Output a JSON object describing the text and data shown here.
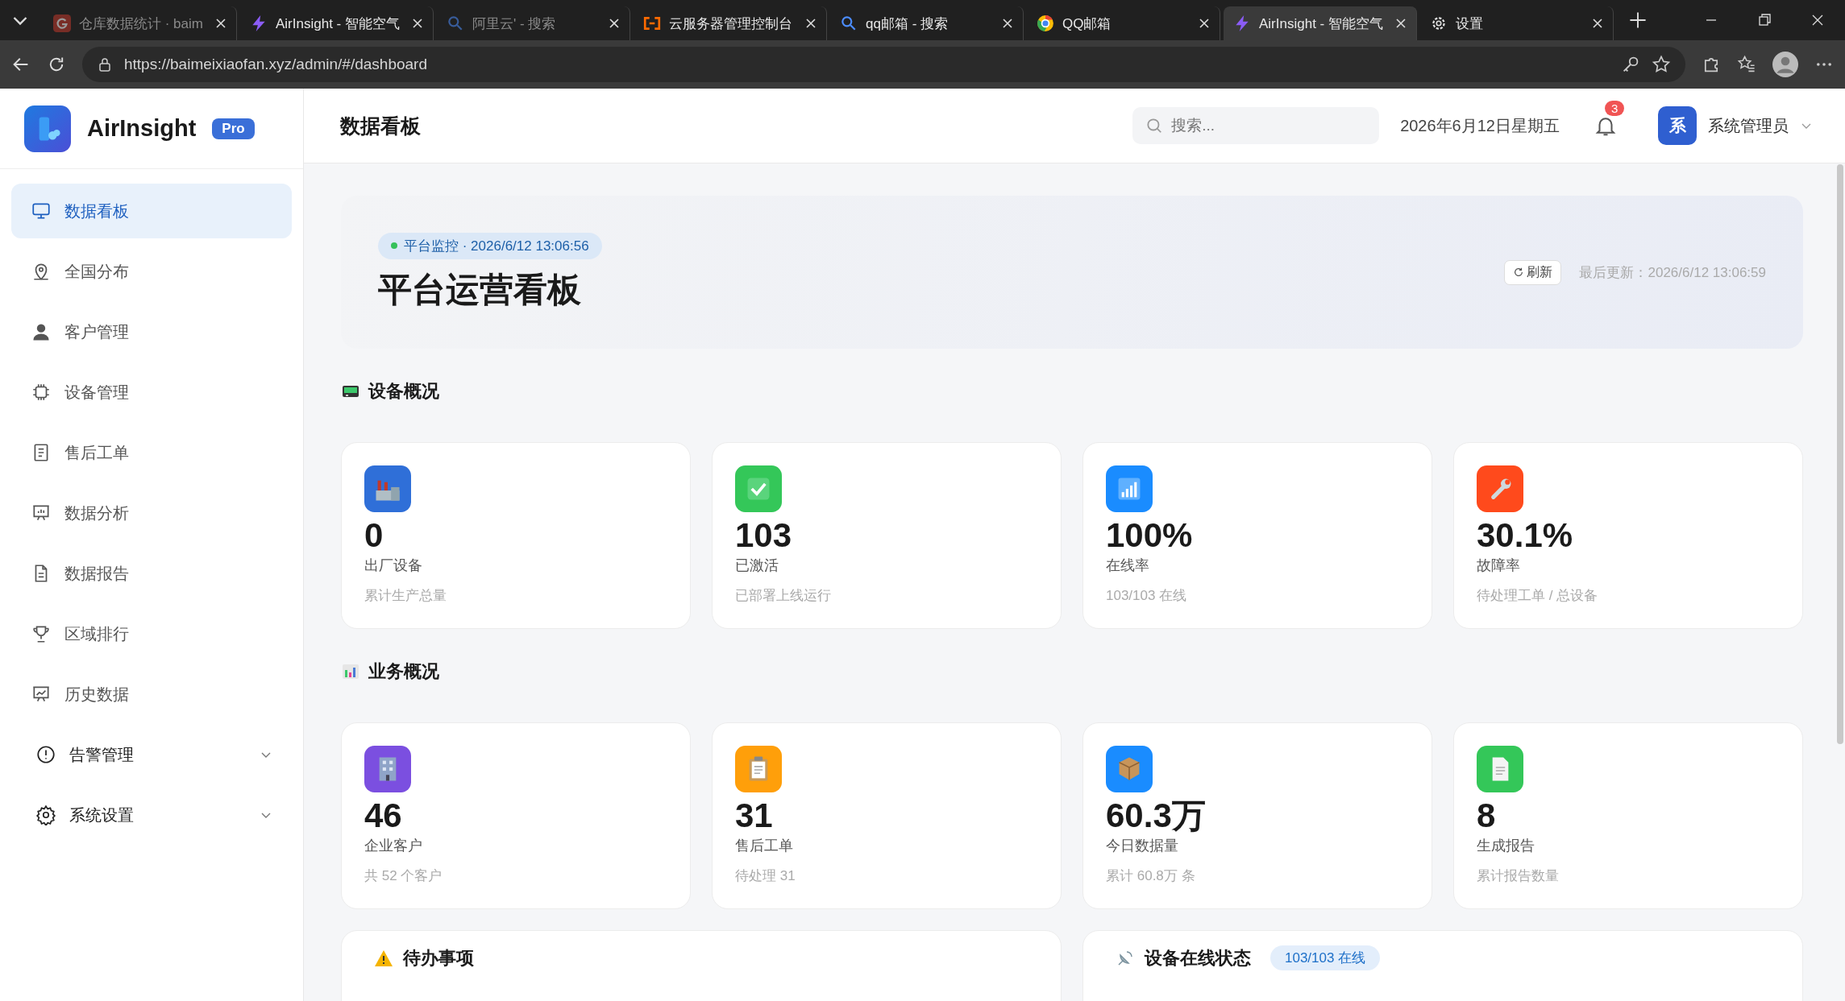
{
  "browser": {
    "tabs": [
      {
        "title": "仓库数据统计 · baim",
        "kind": "g",
        "selected": false,
        "sleeping": true
      },
      {
        "title": "AirInsight - 智能空气",
        "kind": "bolt",
        "selected": false,
        "sleeping": false
      },
      {
        "title": "阿里云' - 搜索",
        "kind": "search",
        "selected": false,
        "sleeping": true
      },
      {
        "title": "云服务器管理控制台",
        "kind": "bracket",
        "selected": false,
        "sleeping": false
      },
      {
        "title": "qq邮箱 - 搜索",
        "kind": "search",
        "selected": false,
        "sleeping": false
      },
      {
        "title": "QQ邮箱",
        "kind": "ring",
        "selected": false,
        "sleeping": false
      },
      {
        "title": "AirInsight - 智能空气",
        "kind": "bolt",
        "selected": true,
        "sleeping": false
      },
      {
        "title": "设置",
        "kind": "gear",
        "selected": false,
        "sleeping": false
      }
    ],
    "url": "https://baimeixiaofan.xyz/admin/#/dashboard"
  },
  "sidebar": {
    "brand": "AirInsight",
    "badge": "Pro",
    "items": [
      {
        "label": "数据看板",
        "kind": "link",
        "selected": true
      },
      {
        "label": "全国分布",
        "kind": "link",
        "selected": false
      },
      {
        "label": "客户管理",
        "kind": "link",
        "selected": false
      },
      {
        "label": "设备管理",
        "kind": "link",
        "selected": false
      },
      {
        "label": "售后工单",
        "kind": "link",
        "selected": false
      },
      {
        "label": "数据分析",
        "kind": "link",
        "selected": false
      },
      {
        "label": "数据报告",
        "kind": "link",
        "selected": false
      },
      {
        "label": "区域排行",
        "kind": "link",
        "selected": false
      },
      {
        "label": "历史数据",
        "kind": "link",
        "selected": false
      },
      {
        "label": "告警管理",
        "kind": "group",
        "selected": false
      },
      {
        "label": "系统设置",
        "kind": "group",
        "selected": false
      }
    ]
  },
  "header": {
    "title": "数据看板",
    "search_placeholder": "搜索...",
    "date": "2026年6月12日星期五",
    "notifications": "3",
    "avatar": "系",
    "user": "系统管理员"
  },
  "banner": {
    "status": "平台监控 · 2026/6/12 13:06:56",
    "title": "平台运营看板",
    "refresh": "刷新",
    "updated": "最后更新：2026/6/12 13:06:59"
  },
  "sections": [
    {
      "title": "设备概况",
      "kind": "device",
      "cards": [
        {
          "value": "0",
          "label": "出厂设备",
          "note": "累计生产总量",
          "kind": "factory",
          "color": "#2f6fd8"
        },
        {
          "value": "103",
          "label": "已激活",
          "note": "已部署上线运行",
          "kind": "check",
          "color": "#34c759"
        },
        {
          "value": "100%",
          "label": "在线率",
          "note": "103/103 在线",
          "kind": "bars",
          "color": "#1a8cff"
        },
        {
          "value": "30.1%",
          "label": "故障率",
          "note": "待处理工单 / 总设备",
          "kind": "wrench",
          "color": "#ff4a1c"
        }
      ]
    },
    {
      "title": "业务概况",
      "kind": "chart",
      "cards": [
        {
          "value": "46",
          "label": "企业客户",
          "note": "共 52 个客户",
          "kind": "building",
          "color": "#7b4fe0"
        },
        {
          "value": "31",
          "label": "售后工单",
          "note": "待处理 31",
          "kind": "clipboard",
          "color": "#ff9f0a"
        },
        {
          "value": "60.3万",
          "label": "今日数据量",
          "note": "累计 60.8万 条",
          "kind": "box",
          "color": "#1a8cff"
        },
        {
          "value": "8",
          "label": "生成报告",
          "note": "累计报告数量",
          "kind": "doc",
          "color": "#34c759"
        }
      ]
    }
  ],
  "panels": [
    {
      "title": "待办事项",
      "kind": "warning"
    },
    {
      "title": "设备在线状态",
      "kind": "antenna",
      "badge": "103/103 在线"
    }
  ]
}
